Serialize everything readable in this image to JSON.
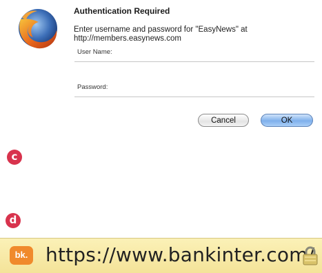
{
  "dialog": {
    "title": "Authentication Required",
    "message": "Enter username and password for \"EasyNews\" at http://members.easynews.com",
    "username_label": "User Name:",
    "username_value": "",
    "password_label": "Password:",
    "password_value": "",
    "cancel_label": "Cancel",
    "ok_label": "OK"
  },
  "markers": {
    "c": "c",
    "d": "d"
  },
  "urlbar": {
    "site_icon_text": "bk.",
    "url": "https://www.bankinter.com/",
    "icons": [
      "firefox-logo",
      "bankinter-site-icon",
      "lock-icon"
    ]
  },
  "colors": {
    "marker": "#d8334d",
    "ok_button": "#7fb0ec",
    "urlbar_background": "#f4e399",
    "site_icon": "#f08a2c"
  }
}
